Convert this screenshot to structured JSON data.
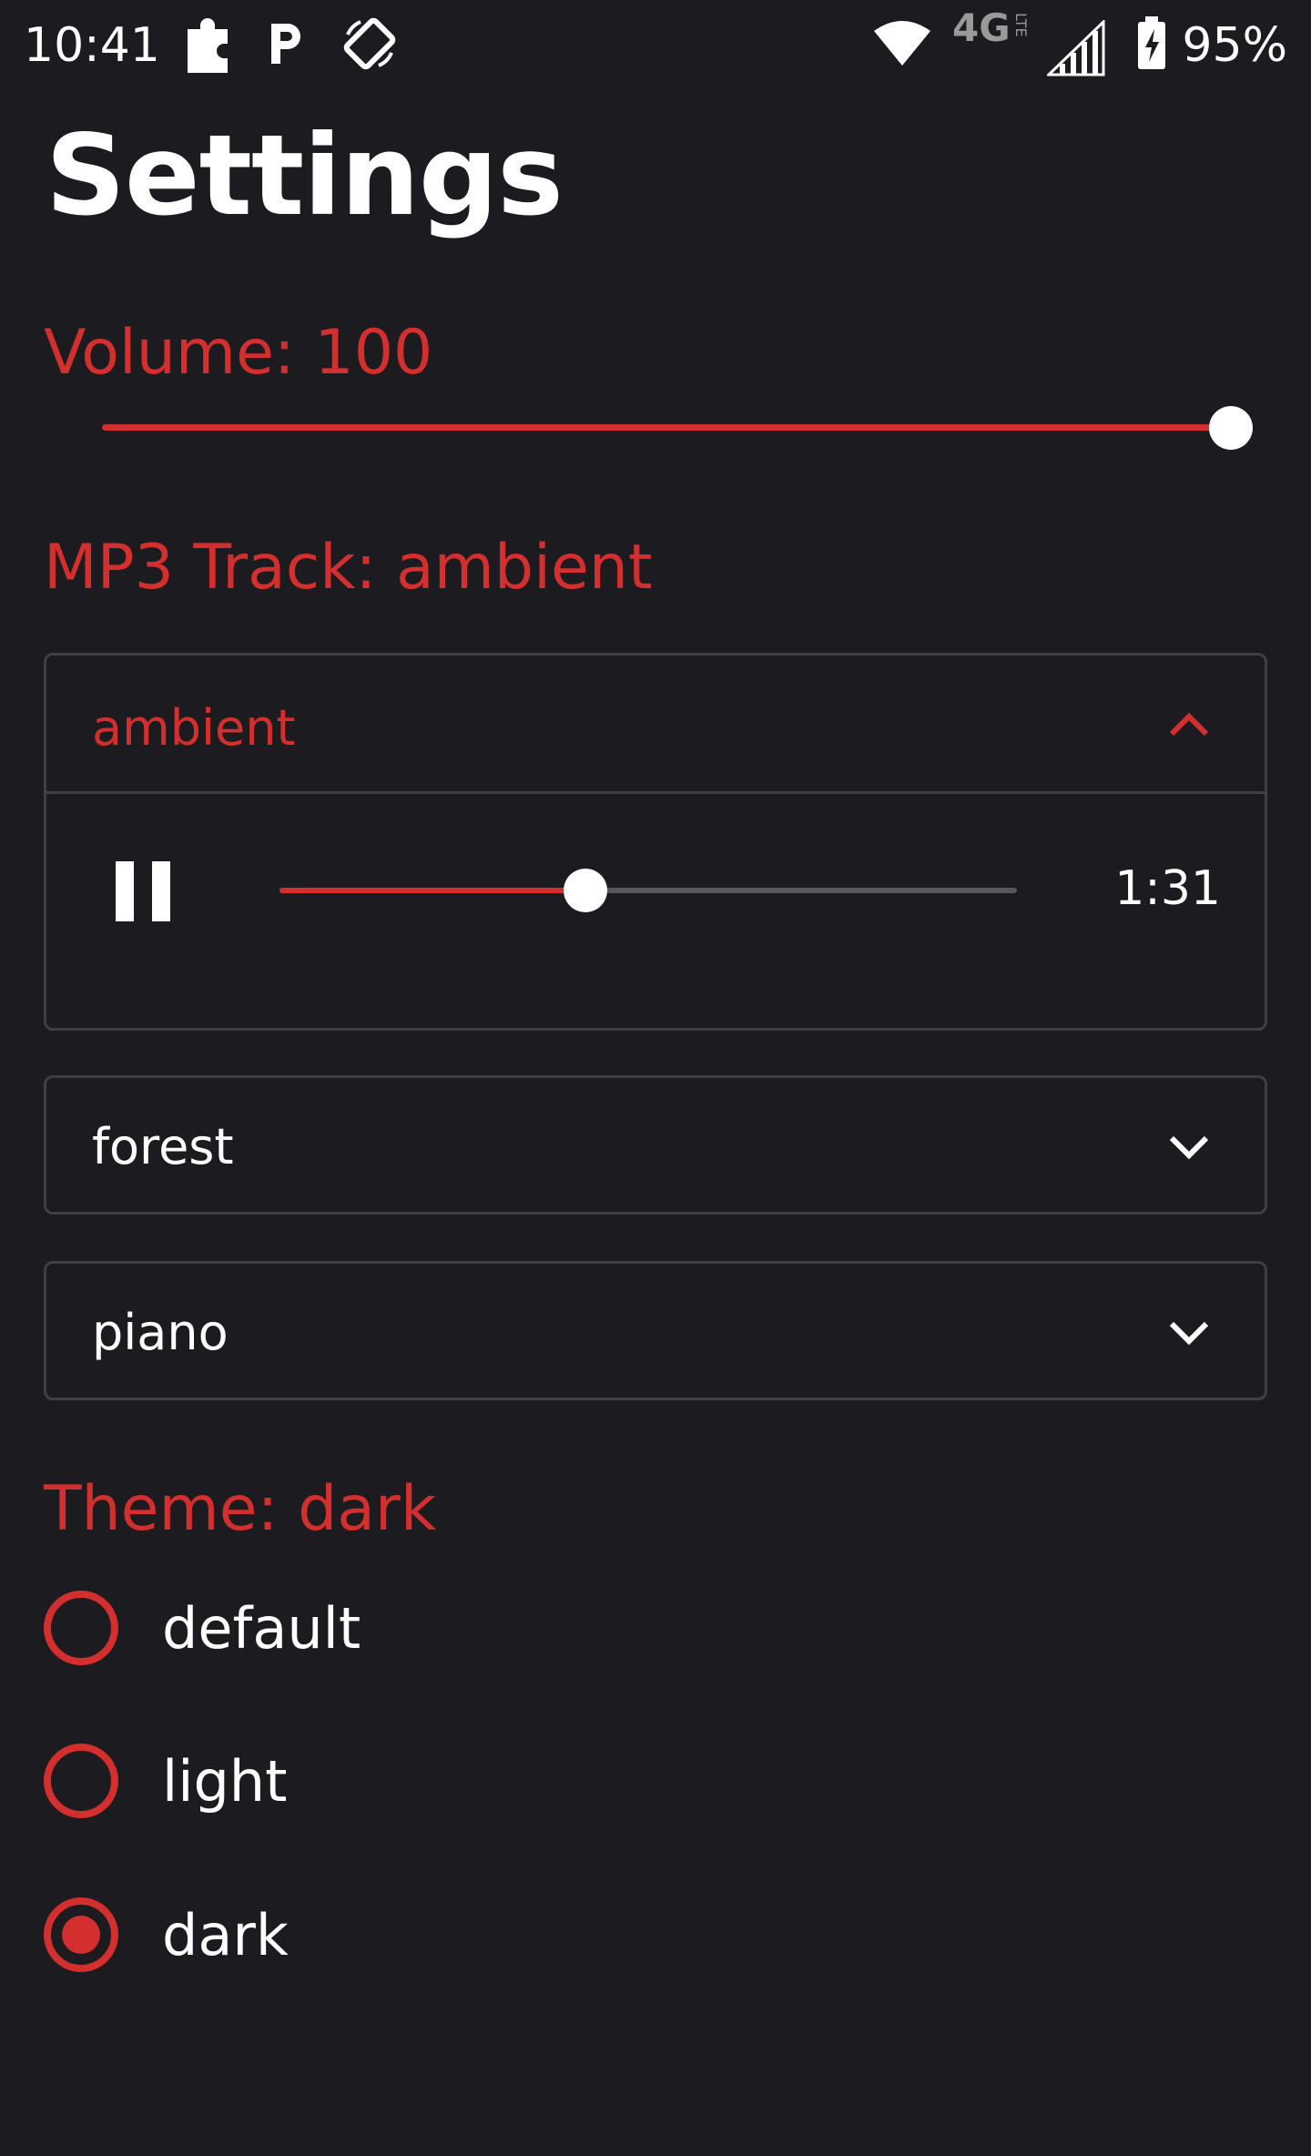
{
  "status_bar": {
    "time": "10:41",
    "battery": "95%",
    "network": "4G",
    "network_sub": "LTE",
    "icons": [
      "puzzle-icon",
      "parking-icon",
      "screen-rotate-icon",
      "wifi-icon",
      "signal-icon",
      "battery-charging-icon"
    ]
  },
  "title": "Settings",
  "volume": {
    "label": "Volume: 100",
    "value": 100,
    "max": 100
  },
  "track": {
    "label": "MP3 Track: ambient",
    "items": [
      {
        "name": "ambient",
        "expanded": true,
        "time": "1:31",
        "progress": 0.415
      },
      {
        "name": "forest",
        "expanded": false
      },
      {
        "name": "piano",
        "expanded": false
      }
    ]
  },
  "theme": {
    "label": "Theme: dark",
    "options": [
      {
        "label": "default",
        "selected": false
      },
      {
        "label": "light",
        "selected": false
      },
      {
        "label": "dark",
        "selected": true
      }
    ]
  },
  "colors": {
    "accent": "#d32f2f",
    "background": "#1c1b1f",
    "border": "#3f3f44",
    "text": "#ffffff"
  }
}
